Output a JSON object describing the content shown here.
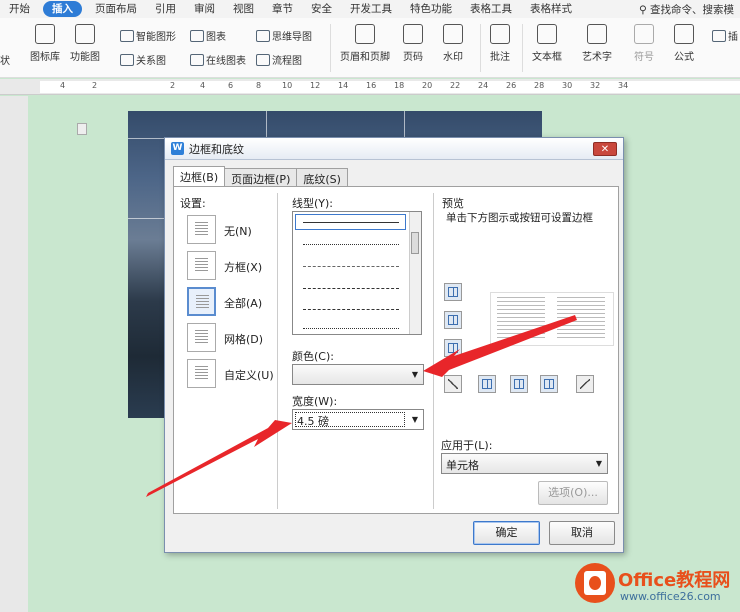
{
  "ribbon": {
    "tabs": [
      "开始",
      "插入",
      "页面布局",
      "引用",
      "审阅",
      "视图",
      "章节",
      "安全",
      "开发工具",
      "特色功能",
      "表格工具",
      "表格样式"
    ],
    "active_tab": "插入",
    "search": "查找命令、搜索模",
    "tools": {
      "shape": "状",
      "icon_lib": "图标库",
      "func_chart": "功能图",
      "smart_shape": "智能图形",
      "chart": "图表",
      "mind_map": "思维导图",
      "relation": "关系图",
      "online_chart": "在线图表",
      "flowchart": "流程图",
      "header_footer": "页眉和页脚",
      "page_num": "页码",
      "watermark": "水印",
      "comment": "批注",
      "textbox": "文本框",
      "wordart": "艺术字",
      "symbol": "符号",
      "formula": "公式",
      "insert_partial": "插"
    }
  },
  "ruler": [
    "4",
    "2",
    "2",
    "4",
    "6",
    "8",
    "10",
    "12",
    "14",
    "16",
    "18",
    "20",
    "22",
    "24",
    "26",
    "28",
    "30",
    "32",
    "34"
  ],
  "dialog": {
    "title": "边框和底纹",
    "close": "✕",
    "tabs": [
      "边框(B)",
      "页面边框(P)",
      "底纹(S)"
    ],
    "settings_label": "设置:",
    "settings": [
      "无(N)",
      "方框(X)",
      "全部(A)",
      "网格(D)",
      "自定义(U)"
    ],
    "selected_setting": "全部(A)",
    "linestyle_label": "线型(Y):",
    "color_label": "颜色(C):",
    "color_value": "",
    "width_label": "宽度(W):",
    "width_value": "4.5  磅",
    "preview_label": "预览",
    "preview_hint": "单击下方图示或按钮可设置边框",
    "apply_label": "应用于(L):",
    "apply_value": "单元格",
    "options_button": "选项(O)...",
    "ok_button": "确定",
    "cancel_button": "取消"
  },
  "watermark": {
    "brand": "Office教程网",
    "url": "www.office26.com"
  },
  "colors": {
    "accent": "#2e7cd6",
    "arrow": "#e8262a",
    "doc_bg": "#c9e7cf",
    "brand": "#e8501c"
  }
}
